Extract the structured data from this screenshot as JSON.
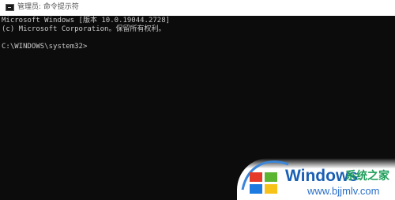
{
  "window": {
    "title": "管理员: 命令提示符",
    "icon": "cmd-console-icon"
  },
  "console": {
    "lines": [
      "Microsoft Windows [版本 10.0.19044.2728]",
      "(c) Microsoft Corporation。保留所有权利。",
      "",
      "C:\\WINDOWS\\system32>"
    ],
    "text_color": "#c8c8c8",
    "background": "#0c0c0c"
  },
  "watermark": {
    "brand": "Windows",
    "site_name": "系统之家",
    "url": "www.bjjmlv.com",
    "logo": "windows-flag-logo",
    "colors": {
      "red": "#e53a2a",
      "green": "#5cb531",
      "blue": "#1c7ae0",
      "yellow": "#f7c21a",
      "text_blue": "#1a5fb4"
    }
  }
}
